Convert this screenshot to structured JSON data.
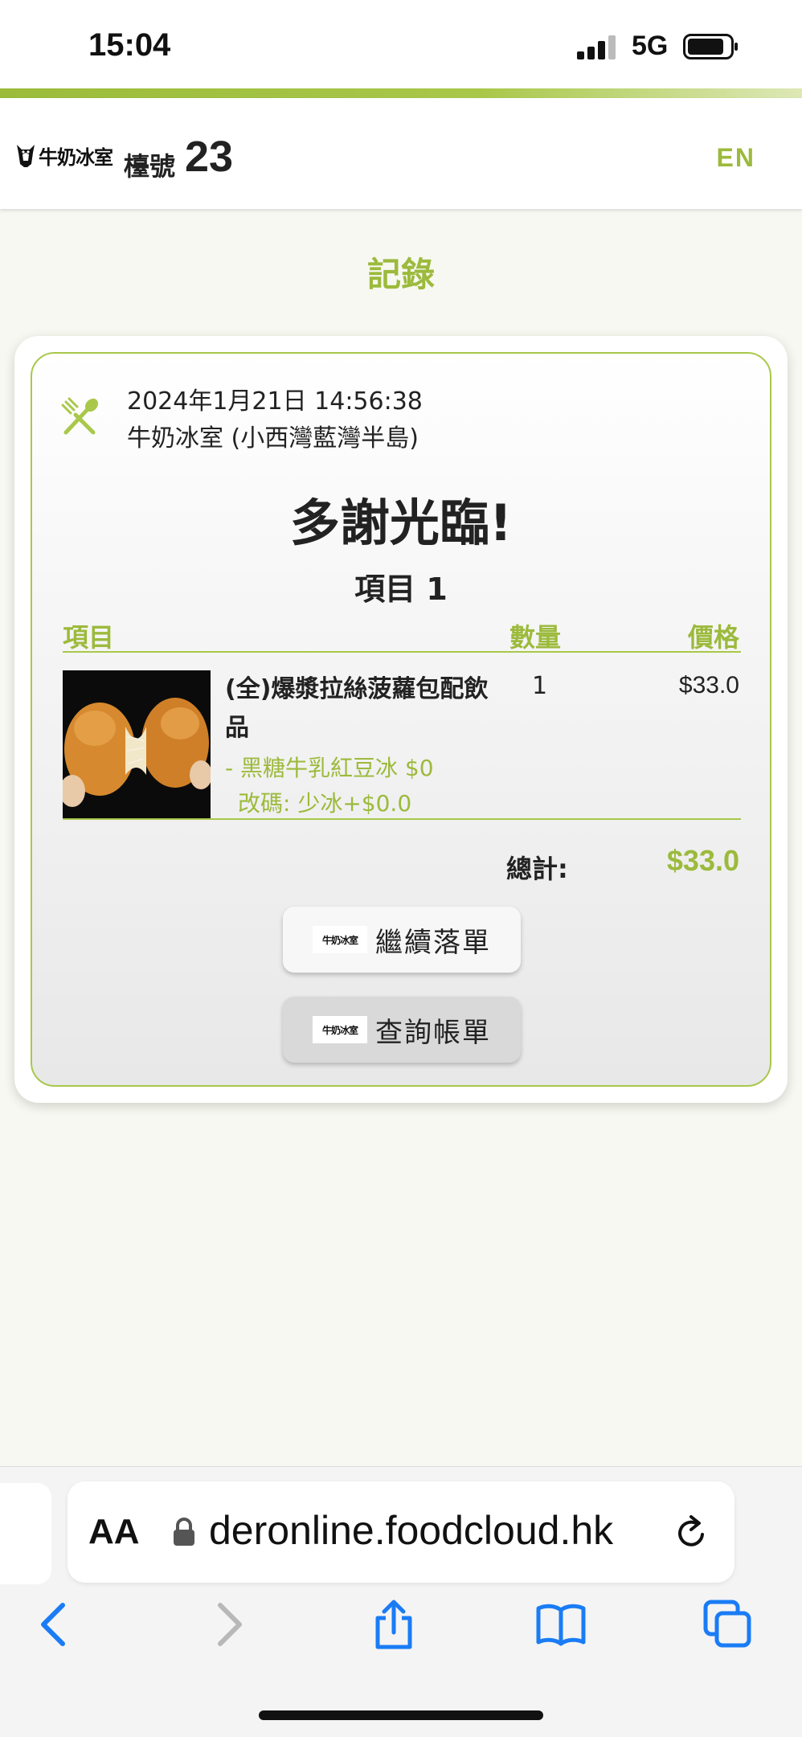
{
  "status_bar": {
    "time": "15:04",
    "network": "5G"
  },
  "header": {
    "logo_text": "牛奶冰室",
    "table_label": "檯號",
    "table_number": "23",
    "lang_toggle": "EN"
  },
  "page": {
    "title": "記錄"
  },
  "order": {
    "datetime": "2024年1月21日 14:56:38",
    "restaurant": "牛奶冰室 (小西灣藍灣半島)",
    "thanks": "多謝光臨!",
    "item_count_label": "項目 1",
    "columns": {
      "item": "項目",
      "quantity": "數量",
      "price": "價格"
    },
    "items": [
      {
        "name": "(全)爆漿拉絲菠蘿包配飲品",
        "quantity": "1",
        "price": "$33.0",
        "option": "- 黑糖牛乳紅豆冰 $0",
        "modifier": "改碼: 少冰+$0.0"
      }
    ],
    "total_label": "總計:",
    "total_value": "$33.0"
  },
  "buttons": {
    "logo_text": "牛奶冰室",
    "continue": "繼續落單",
    "bill": "查詢帳單"
  },
  "browser": {
    "aa": "AA",
    "url": "deronline.foodcloud.hk"
  },
  "colors": {
    "accent": "#9cba3c",
    "ios_blue": "#1a7cf5"
  },
  "icons": [
    "signal-icon",
    "battery-icon",
    "cutlery-icon",
    "lock-icon",
    "reload-icon",
    "back-icon",
    "forward-icon",
    "share-icon",
    "bookmarks-icon",
    "tabs-icon"
  ]
}
